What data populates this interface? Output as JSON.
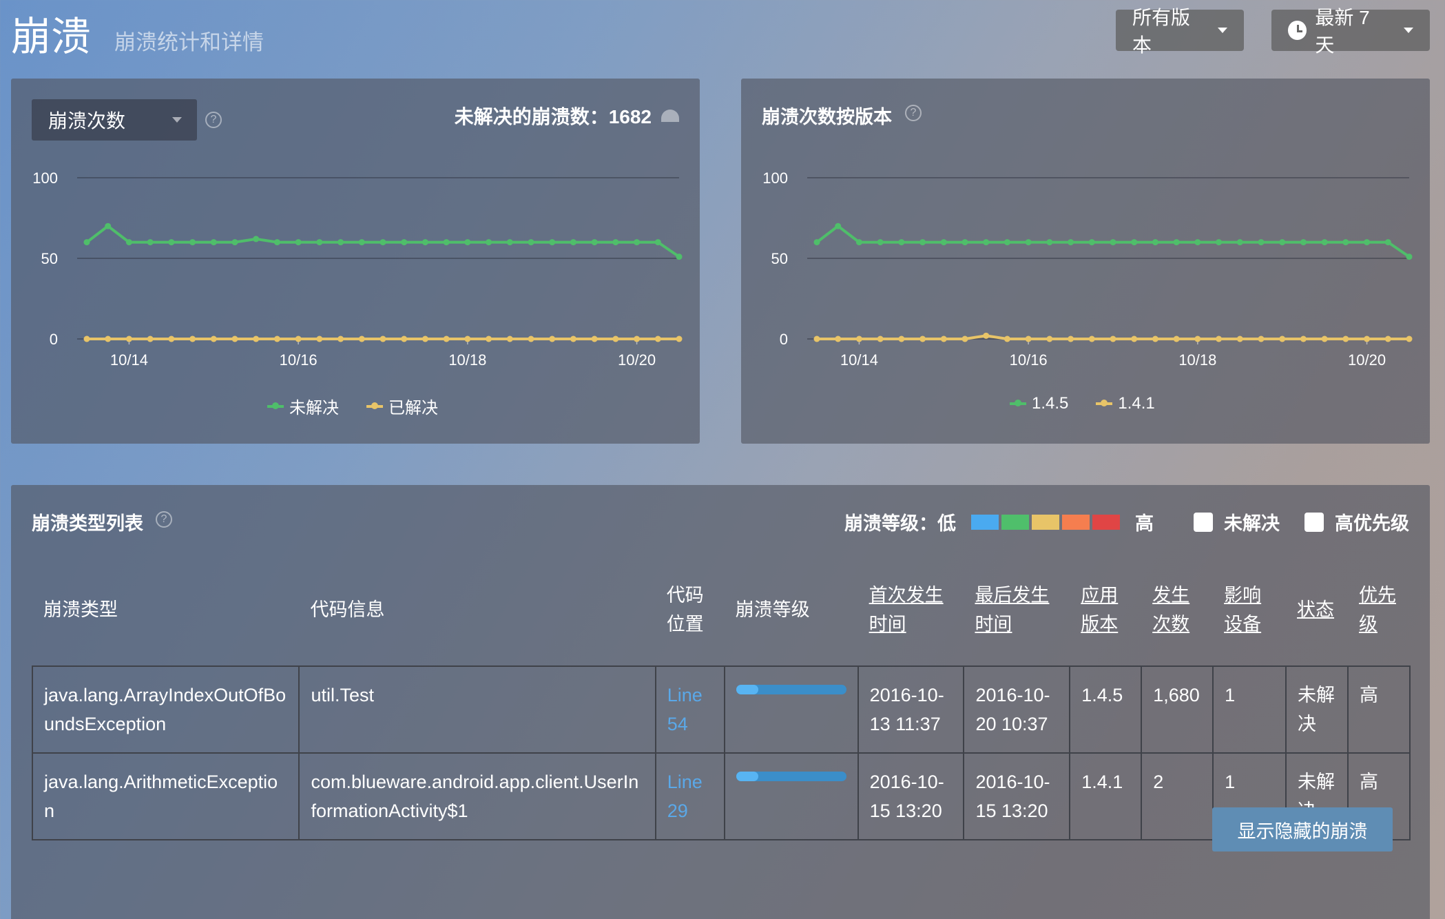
{
  "header": {
    "title": "崩溃",
    "subtitle": "崩溃统计和详情",
    "version_filter": "所有版本",
    "range_filter": "最新 7 天"
  },
  "left_panel": {
    "metric_select": "崩溃次数",
    "unresolved_label": "未解决的崩溃数：1682"
  },
  "right_panel": {
    "title": "崩溃次数按版本"
  },
  "colors": {
    "green": "#4fbe6a",
    "yellow": "#e8c468",
    "level_1": "#4aaaf0",
    "level_2": "#4fbf6b",
    "level_3": "#e8c468",
    "level_4": "#f57e4f",
    "level_5": "#e04545"
  },
  "chart_data": [
    {
      "type": "line",
      "xlabel": "",
      "ylabel": "",
      "ylim": [
        0,
        100
      ],
      "yticks": [
        "100",
        "50",
        "0"
      ],
      "xticks": [
        "10/14",
        "10/16",
        "10/18",
        "10/20"
      ],
      "legend": "bottom",
      "grid": true,
      "series": [
        {
          "name": "未解决",
          "color": "#4fbe6a",
          "values": [
            60,
            70,
            60,
            60,
            60,
            60,
            60,
            60,
            62,
            60,
            60,
            60,
            60,
            60,
            60,
            60,
            60,
            60,
            60,
            60,
            60,
            60,
            60,
            60,
            60,
            60,
            60,
            60,
            51
          ]
        },
        {
          "name": "已解决",
          "color": "#e8c468",
          "values": [
            0,
            0,
            0,
            0,
            0,
            0,
            0,
            0,
            0,
            0,
            0,
            0,
            0,
            0,
            0,
            0,
            0,
            0,
            0,
            0,
            0,
            0,
            0,
            0,
            0,
            0,
            0,
            0,
            0
          ]
        }
      ]
    },
    {
      "type": "line",
      "xlabel": "",
      "ylabel": "",
      "ylim": [
        0,
        100
      ],
      "yticks": [
        "100",
        "50",
        "0"
      ],
      "xticks": [
        "10/14",
        "10/16",
        "10/18",
        "10/20"
      ],
      "legend": "bottom",
      "grid": true,
      "series": [
        {
          "name": "1.4.5",
          "color": "#4fbe6a",
          "values": [
            60,
            70,
            60,
            60,
            60,
            60,
            60,
            60,
            60,
            60,
            60,
            60,
            60,
            60,
            60,
            60,
            60,
            60,
            60,
            60,
            60,
            60,
            60,
            60,
            60,
            60,
            60,
            60,
            51
          ]
        },
        {
          "name": "1.4.1",
          "color": "#e8c468",
          "values": [
            0,
            0,
            0,
            0,
            0,
            0,
            0,
            0,
            2,
            0,
            0,
            0,
            0,
            0,
            0,
            0,
            0,
            0,
            0,
            0,
            0,
            0,
            0,
            0,
            0,
            0,
            0,
            0,
            0
          ]
        }
      ]
    }
  ],
  "list": {
    "title": "崩溃类型列表",
    "level_label": "崩溃等级：低",
    "level_high": "高",
    "filter_unresolved": "未解决",
    "filter_priority": "高优先级",
    "columns": [
      "崩溃类型",
      "代码信息",
      "代码位置",
      "崩溃等级",
      "首次发生时间",
      "最后发生时间",
      "应用版本",
      "发生次数",
      "影响设备",
      "状态",
      "优先级"
    ],
    "rows": [
      {
        "type": "java.lang.ArrayIndexOutOfBoundsException",
        "code": "util.Test",
        "location": "Line 54",
        "level": 0.2,
        "first": "2016-10-13 11:37",
        "last": "2016-10-20 10:37",
        "version": "1.4.5",
        "count": "1,680",
        "devices": "1",
        "status": "未解决",
        "priority": "高"
      },
      {
        "type": "java.lang.ArithmeticException",
        "code": "com.blueware.android.app.client.UserInformationActivity$1",
        "location": "Line 29",
        "level": 0.2,
        "first": "2016-10-15 13:20",
        "last": "2016-10-15 13:20",
        "version": "1.4.1",
        "count": "2",
        "devices": "1",
        "status": "未解决",
        "priority": "高"
      }
    ],
    "show_hidden": "显示隐藏的崩溃"
  }
}
